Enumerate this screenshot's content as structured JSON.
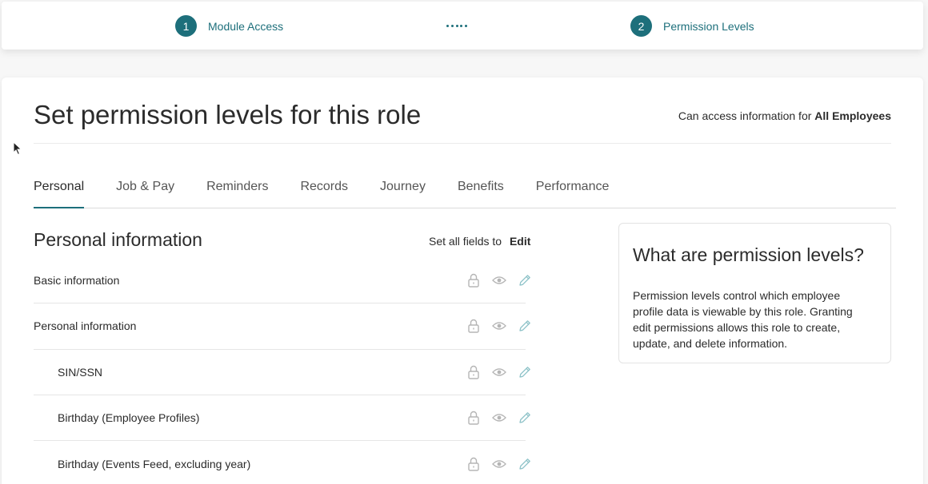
{
  "stepper": {
    "steps": [
      {
        "number": "1",
        "label": "Module Access"
      },
      {
        "number": "2",
        "label": "Permission Levels"
      }
    ]
  },
  "header": {
    "title": "Set permission levels for this role",
    "access_prefix": "Can access information for",
    "access_value": "All Employees"
  },
  "tabs": [
    {
      "label": "Personal",
      "active": true
    },
    {
      "label": "Job & Pay"
    },
    {
      "label": "Reminders"
    },
    {
      "label": "Records"
    },
    {
      "label": "Journey"
    },
    {
      "label": "Benefits"
    },
    {
      "label": "Performance"
    }
  ],
  "section": {
    "title": "Personal information",
    "set_all_label": "Set all fields to",
    "set_all_value": "Edit"
  },
  "rows": [
    {
      "label": "Basic information"
    },
    {
      "label": "Personal information"
    },
    {
      "label": "SIN/SSN"
    },
    {
      "label": "Birthday (Employee Profiles)"
    },
    {
      "label": "Birthday (Events Feed, excluding year)"
    }
  ],
  "icons": {
    "lock": "lock-icon",
    "view": "eye-icon",
    "edit": "pencil-icon"
  },
  "info": {
    "title": "What are permission levels?",
    "body": "Permission levels control which employee profile data is viewable by this role. Granting edit permissions allows this role to create, update, and delete information."
  },
  "colors": {
    "accent": "#1d6f7b",
    "icon_grey": "#b5b5b5",
    "icon_edit": "#8fc3c9"
  }
}
